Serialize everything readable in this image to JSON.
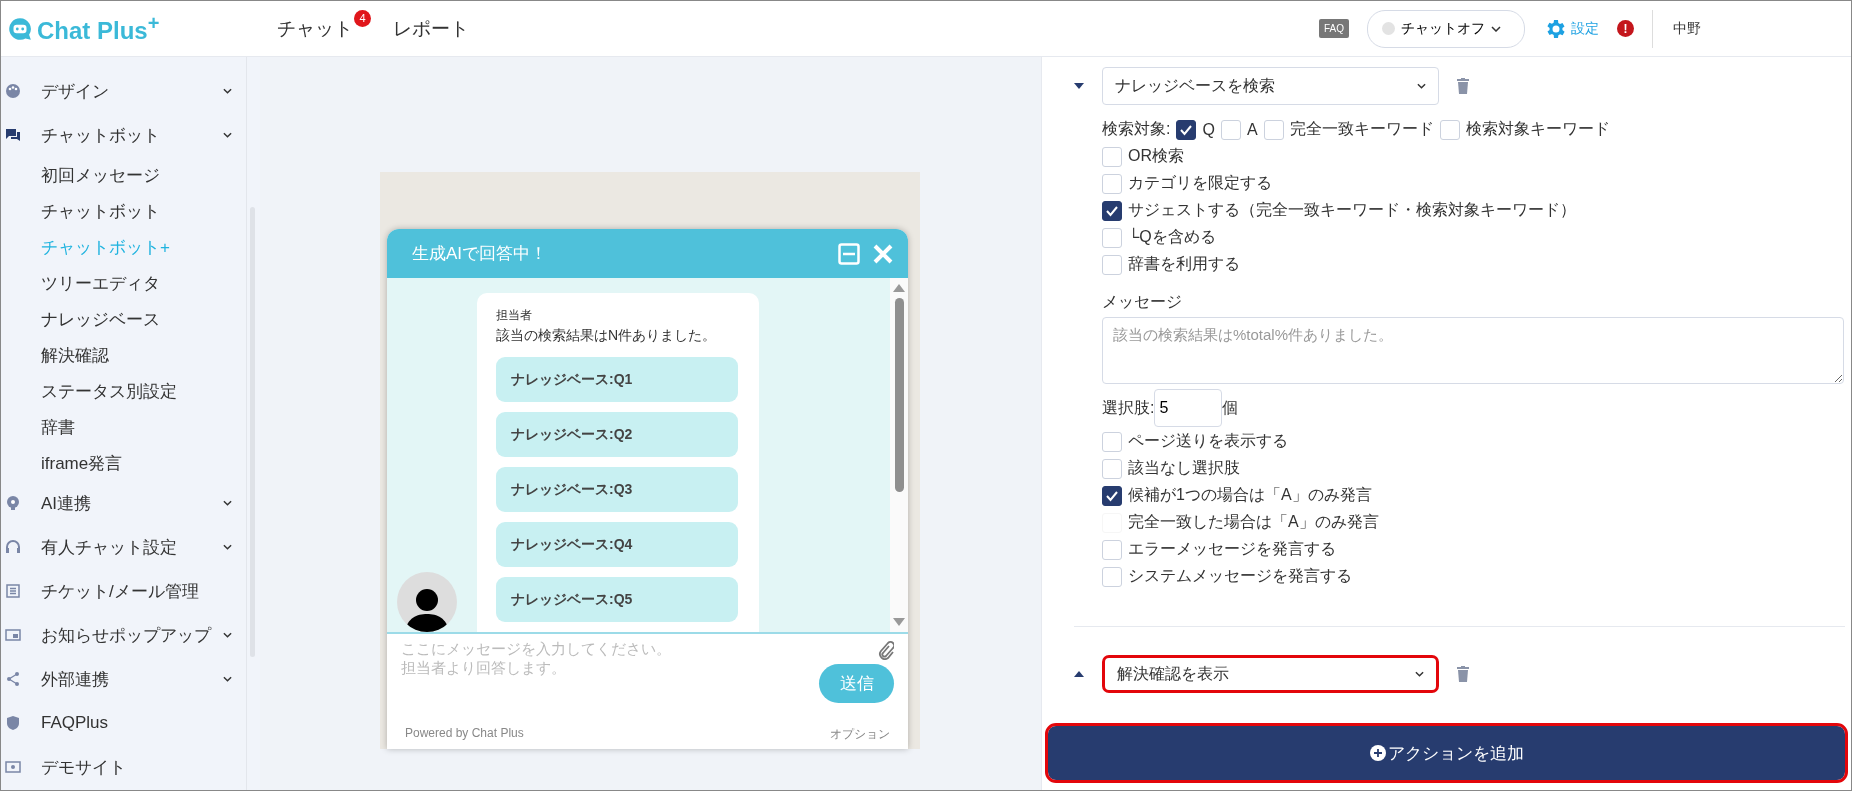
{
  "header": {
    "logo": "Chat Plus$^{+}$",
    "nav": [
      {
        "label": "チャット",
        "badge": "4"
      },
      {
        "label": "レポート"
      }
    ],
    "faq_label": "FAQ",
    "status": {
      "label": "チャットオフ",
      "online": false
    },
    "settings_label": "設定",
    "alert_mark": "!",
    "user": "中野"
  },
  "sidebar": {
    "items": [
      {
        "label": "デザイン",
        "expandable": true
      },
      {
        "label": "チャットボット",
        "expandable": true,
        "children": [
          {
            "label": "初回メッセージ",
            "selected": false
          },
          {
            "label": "チャットボット",
            "selected": false
          },
          {
            "label": "チャットボット+",
            "selected": true
          },
          {
            "label": "ツリーエディタ",
            "selected": false
          },
          {
            "label": "ナレッジベース",
            "selected": false
          },
          {
            "label": "解決確認",
            "selected": false
          },
          {
            "label": "ステータス別設定",
            "selected": false
          },
          {
            "label": "辞書",
            "selected": false
          },
          {
            "label": "iframe発言",
            "selected": false
          }
        ]
      },
      {
        "label": "AI連携",
        "expandable": true
      },
      {
        "label": "有人チャット設定",
        "expandable": true
      },
      {
        "label": "チケット/メール管理",
        "expandable": false
      },
      {
        "label": "お知らせポップアップ",
        "expandable": true
      },
      {
        "label": "外部連携",
        "expandable": true
      },
      {
        "label": "FAQPlus",
        "expandable": false
      },
      {
        "label": "デモサイト",
        "expandable": false
      }
    ]
  },
  "preview": {
    "title": "生成AIで回答中！",
    "sender": "担当者",
    "message": "該当の検索結果はN件ありました。",
    "choices": [
      "ナレッジベース:Q1",
      "ナレッジベース:Q2",
      "ナレッジベース:Q3",
      "ナレッジベース:Q4",
      "ナレッジベース:Q5"
    ],
    "input_placeholder": "ここにメッセージを入力してください。担当者より回答します。",
    "send": "送信",
    "powered": "Powered by Chat Plus",
    "option": "オプション"
  },
  "actions": [
    {
      "expanded": true,
      "highlighted": false,
      "value": "ナレッジベースを検索",
      "search_target": {
        "label": "検索対象:",
        "options": [
          {
            "label": "Q",
            "checked": true
          },
          {
            "label": "A",
            "checked": false
          },
          {
            "label": "完全一致キーワード",
            "checked": false
          },
          {
            "label": "検索対象キーワード",
            "checked": false
          }
        ]
      },
      "options_a": [
        {
          "label": "OR検索",
          "checked": false,
          "disabled": false
        },
        {
          "label": "カテゴリを限定する",
          "checked": false,
          "disabled": false
        },
        {
          "label": "サジェストする（完全一致キーワード・検索対象キーワード）",
          "checked": true,
          "disabled": false
        },
        {
          "label": "└Qを含める",
          "checked": false,
          "disabled": false
        },
        {
          "label": "辞書を利用する",
          "checked": false,
          "disabled": false
        }
      ],
      "message_label": "メッセージ",
      "message_placeholder": "該当の検索結果は%total%件ありました。",
      "choices_label": "選択肢:",
      "choices_value": "5",
      "choices_unit": "個",
      "options_b": [
        {
          "label": "ページ送りを表示する",
          "checked": false,
          "disabled": false
        },
        {
          "label": "該当なし選択肢",
          "checked": false,
          "disabled": false
        },
        {
          "label": "候補が1つの場合は「A」のみ発言",
          "checked": true,
          "disabled": false
        },
        {
          "label": "完全一致した場合は「A」のみ発言",
          "checked": false,
          "disabled": true
        },
        {
          "label": "エラーメッセージを発言する",
          "checked": false,
          "disabled": false
        },
        {
          "label": "システムメッセージを発言する",
          "checked": false,
          "disabled": false
        }
      ]
    },
    {
      "expanded": false,
      "highlighted": true,
      "value": "解決確認を表示"
    }
  ],
  "add_button": {
    "label": "アクションを追加",
    "highlighted": true
  }
}
